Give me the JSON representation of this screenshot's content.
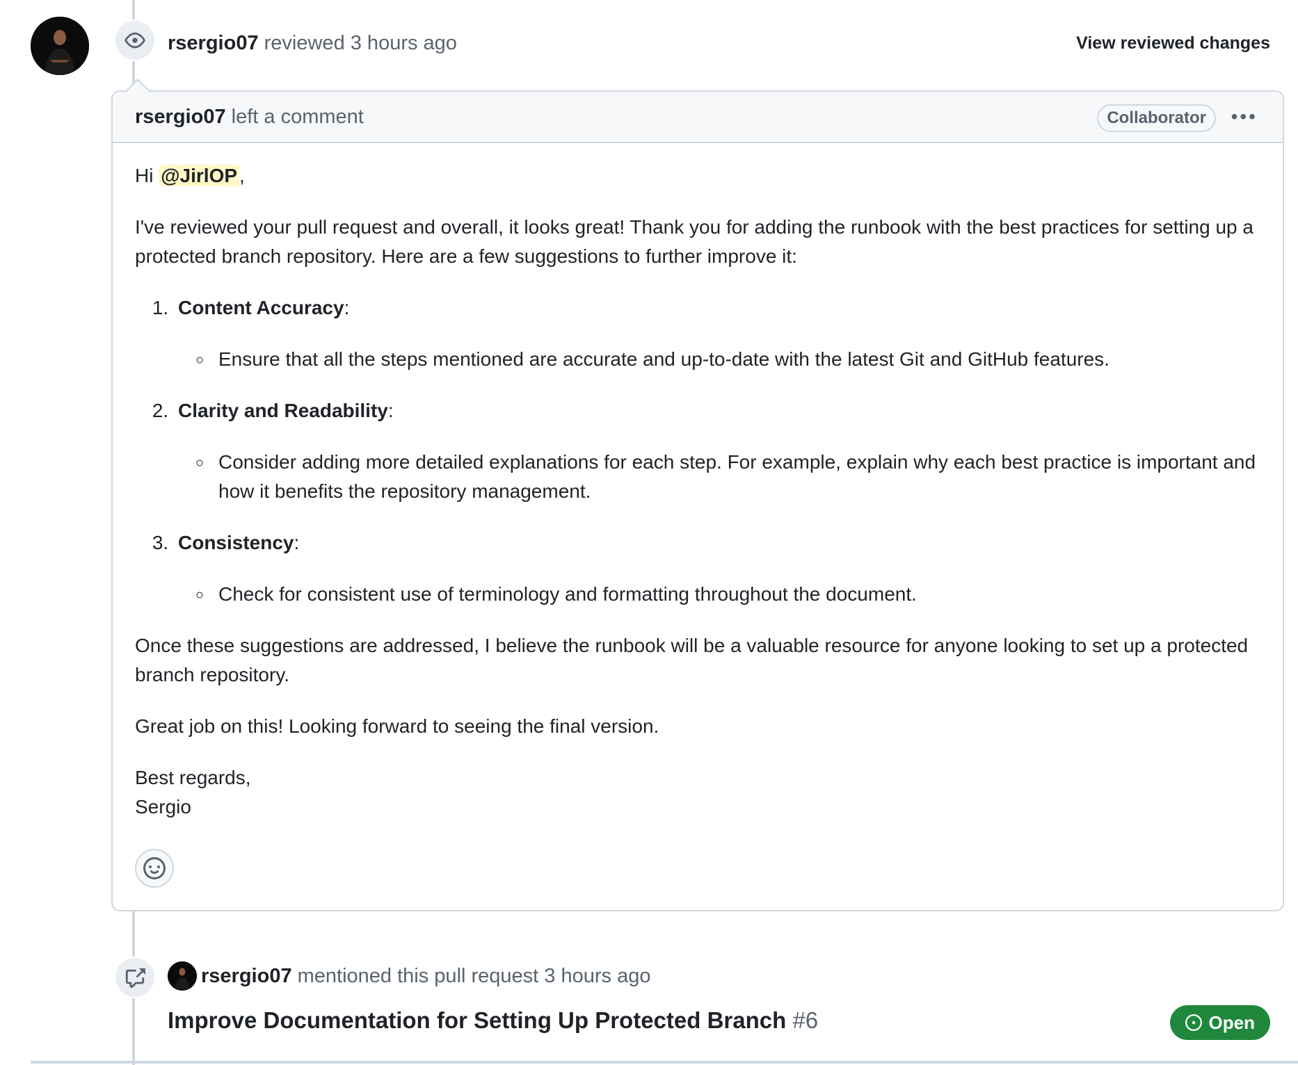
{
  "review": {
    "user": "rsergio07",
    "action": " reviewed ",
    "time": "3 hours ago",
    "view_changes": "View reviewed changes"
  },
  "comment": {
    "user": "rsergio07",
    "action": " left a comment",
    "badge": "Collaborator",
    "greeting_prefix": "Hi ",
    "mention": "@JirlOP",
    "greeting_suffix": ",",
    "intro": "I've reviewed your pull request and overall, it looks great! Thank you for adding the runbook with the best practices for setting up a protected branch repository. Here are a few suggestions to further improve it:",
    "items": [
      {
        "title": "Content Accuracy",
        "detail": "Ensure that all the steps mentioned are accurate and up-to-date with the latest Git and GitHub features."
      },
      {
        "title": "Clarity and Readability",
        "detail": "Consider adding more detailed explanations for each step. For example, explain why each best practice is important and how it benefits the repository management."
      },
      {
        "title": "Consistency",
        "detail": "Check for consistent use of terminology and formatting throughout the document."
      }
    ],
    "closing": "Once these suggestions are addressed, I believe the runbook will be a valuable resource for anyone looking to set up a protected branch repository.",
    "thanks": "Great job on this! Looking forward to seeing the final version.",
    "signoff": "Best regards,",
    "signature": "Sergio"
  },
  "mention_event": {
    "user": "rsergio07",
    "action": " mentioned this pull request ",
    "time": "3 hours ago",
    "pr_title": "Improve Documentation for Setting Up Protected Branch",
    "pr_number": "#6",
    "status": "Open"
  },
  "icons": {
    "review": "eye-icon",
    "comment_menu": "kebab-horizontal-icon",
    "reaction": "smiley-icon",
    "cross_reference": "cross-reference-icon",
    "status": "issue-opened-icon"
  },
  "colors": {
    "mention_highlight": "#fff8c5",
    "open_status": "#1f883d",
    "border": "#d0d7de",
    "muted_text": "#59636e"
  }
}
